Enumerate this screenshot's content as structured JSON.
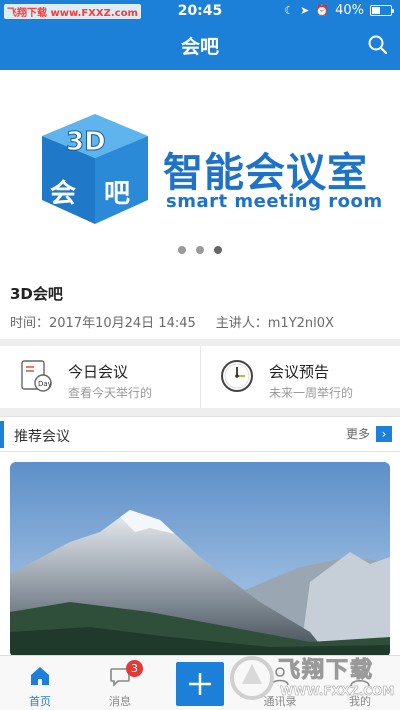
{
  "status_bar": {
    "watermark": "飞翔下载 www.FXXZ.com",
    "time": "20:45",
    "battery": "40%",
    "battery_level": 0.4
  },
  "nav": {
    "title": "会吧",
    "search_icon": "search-icon"
  },
  "banner": {
    "logo_text": "3D会吧",
    "title": "智能会议室",
    "subtitle": "smart meeting room",
    "slide_count": 3,
    "active_slide": 2
  },
  "meeting": {
    "title": "3D会吧",
    "time": "时间：2017年10月24日 14:45",
    "speaker": "主讲人：m1Y2nl0X"
  },
  "quick": [
    {
      "title": "今日会议",
      "subtitle": "查看今天举行的",
      "icon": "calendar-icon"
    },
    {
      "title": "会议预告",
      "subtitle": "未来一周举行的",
      "icon": "clock-icon"
    }
  ],
  "section": {
    "title": "推荐会议",
    "more": "更多"
  },
  "tabs": [
    {
      "label": "首页",
      "icon": "home-icon",
      "active": true
    },
    {
      "label": "消息",
      "icon": "message-icon",
      "badge": "3"
    },
    {
      "label": "",
      "icon": "plus-icon"
    },
    {
      "label": "通讯录",
      "icon": "contacts-icon"
    },
    {
      "label": "我的",
      "icon": "profile-icon"
    }
  ],
  "watermark_logo": {
    "text": "飞翔下载",
    "url": "WWW.FXXZ.COM"
  },
  "colors": {
    "primary": "#1c7fd8",
    "badge": "#e53935"
  }
}
